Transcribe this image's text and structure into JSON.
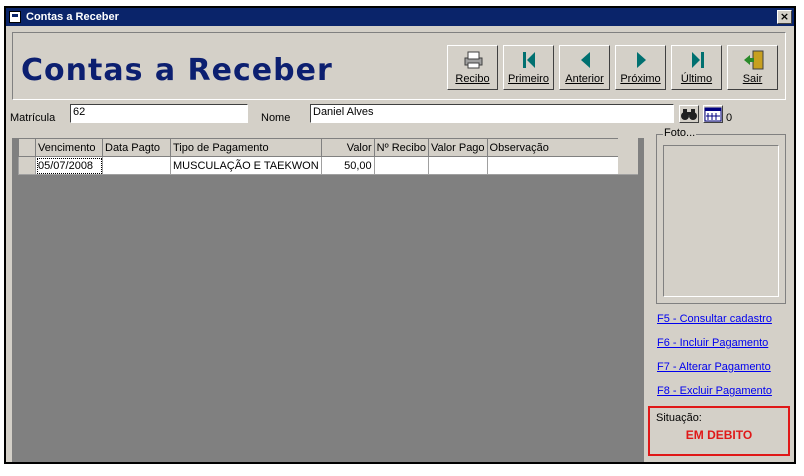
{
  "window": {
    "title": "Contas a Receber",
    "close_label": "×"
  },
  "header": {
    "title": "Contas a Receber"
  },
  "toolbar": {
    "recibo": "Recibo",
    "primeiro": "Primeiro",
    "anterior": "Anterior",
    "proximo": "Próximo",
    "ultimo": "Último",
    "sair": "Sair"
  },
  "form": {
    "matricula_label": "Matrícula",
    "matricula_value": "62",
    "nome_label": "Nome",
    "nome_value": "Daniel Alves",
    "count_value": "0"
  },
  "grid": {
    "columns": [
      "Vencimento",
      "Data Pagto",
      "Tipo de Pagamento",
      "Valor",
      "Nº Recibo",
      "Valor Pago",
      "Observação"
    ],
    "rows": [
      {
        "vencimento": "05/07/2008",
        "data_pagto": "",
        "tipo": "MUSCULAÇÃO E TAEKWON",
        "valor": "50,00",
        "recibo": "",
        "valor_pago": "",
        "observacao": ""
      }
    ]
  },
  "sidebar": {
    "foto_caption": "Foto...",
    "shortcuts": {
      "f5": "F5 - Consultar cadastro",
      "f6": "F6 - Incluir Pagamento",
      "f7": "F7 - Alterar Pagamento",
      "f8": "F8 - Excluir Pagamento"
    },
    "status_label": "Situação:",
    "status_value": "EM DEBITO"
  },
  "colors": {
    "title_bar": "#0a246a",
    "header_title": "#0c1f70",
    "status_alert": "#e01818",
    "link": "#0000ee"
  }
}
